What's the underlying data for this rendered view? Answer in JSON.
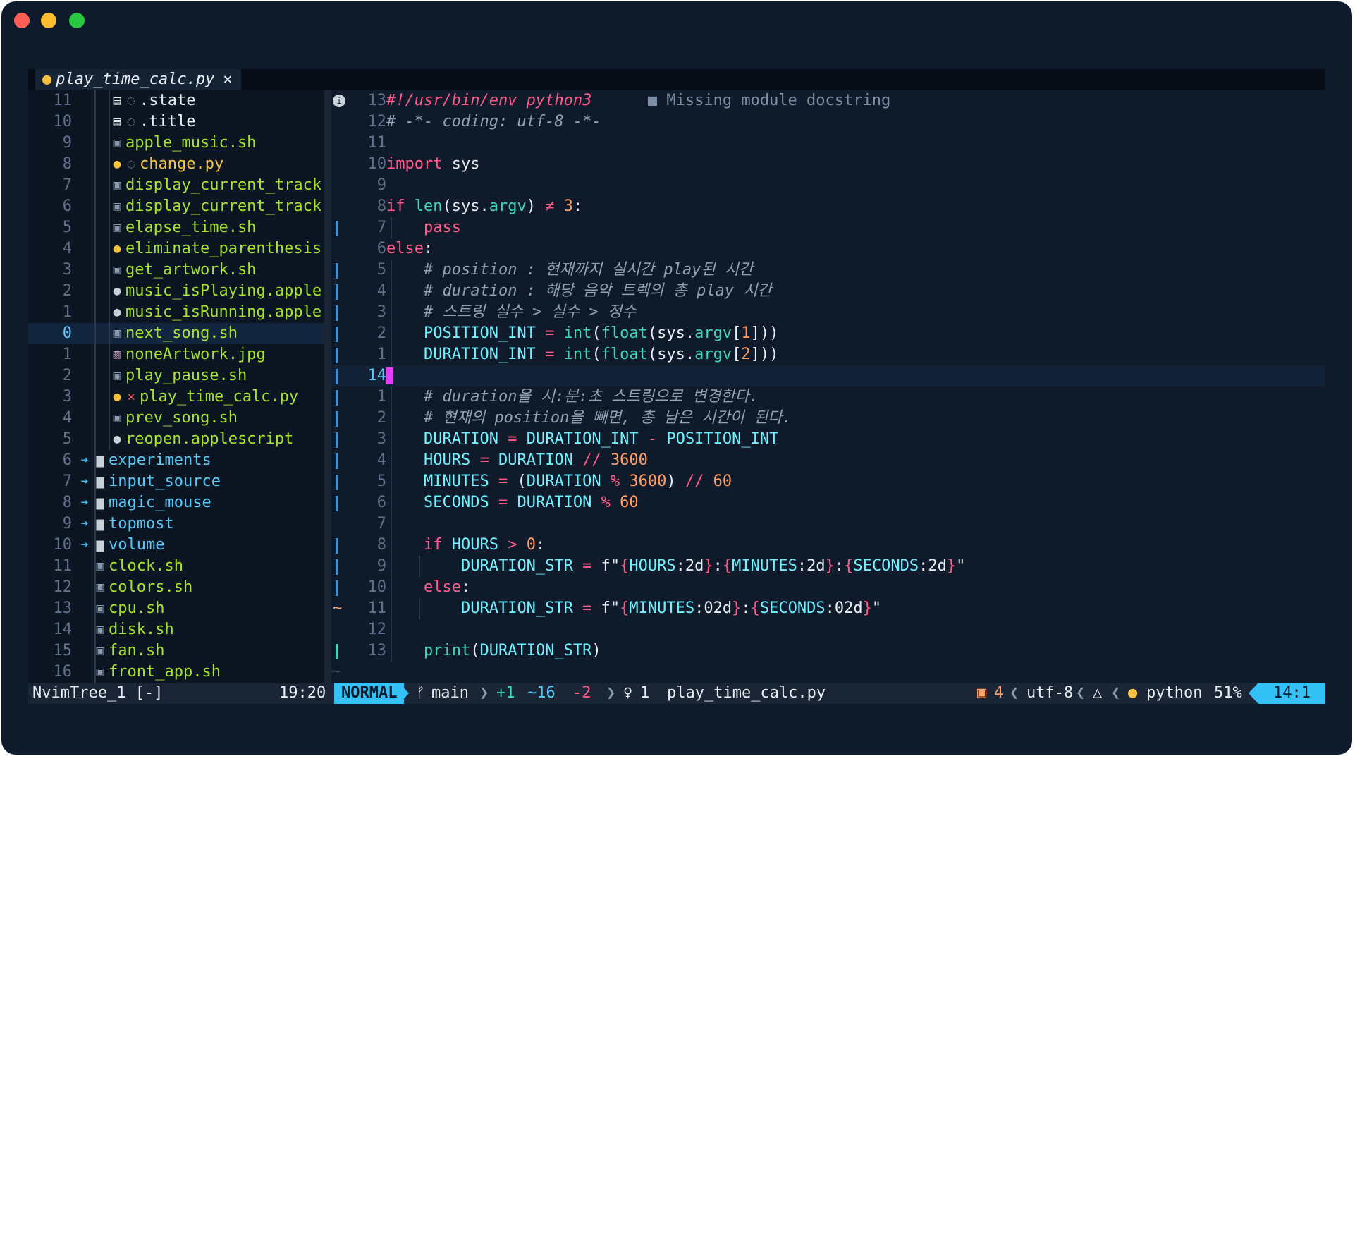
{
  "tab": {
    "icon": "python-icon",
    "filename": "play_time_calc.py",
    "close": "✕"
  },
  "tree": {
    "rows": [
      {
        "ln": "11",
        "depth": 2,
        "icon": "file-icon",
        "mark": "◌",
        "name": ".state",
        "kind": "plain"
      },
      {
        "ln": "10",
        "depth": 2,
        "icon": "file-icon",
        "mark": "◌",
        "name": ".title",
        "kind": "plain"
      },
      {
        "ln": "9",
        "depth": 2,
        "icon": "terminal-icon",
        "name": "apple_music.sh",
        "kind": "sh"
      },
      {
        "ln": "8",
        "depth": 2,
        "icon": "python-icon",
        "mark": "◌",
        "name": "change.py",
        "kind": "py"
      },
      {
        "ln": "7",
        "depth": 2,
        "icon": "terminal-icon",
        "name": "display_current_track",
        "kind": "sh"
      },
      {
        "ln": "6",
        "depth": 2,
        "icon": "terminal-icon",
        "name": "display_current_track",
        "kind": "sh"
      },
      {
        "ln": "5",
        "depth": 2,
        "icon": "terminal-icon",
        "name": "elapse_time.sh",
        "kind": "sh"
      },
      {
        "ln": "4",
        "depth": 2,
        "icon": "python-icon",
        "name": "eliminate_parenthesis",
        "kind": "sh"
      },
      {
        "ln": "3",
        "depth": 2,
        "icon": "terminal-icon",
        "name": "get_artwork.sh",
        "kind": "sh"
      },
      {
        "ln": "2",
        "depth": 2,
        "icon": "apple-icon",
        "name": "music_isPlaying.apple",
        "kind": "sh"
      },
      {
        "ln": "1",
        "depth": 2,
        "icon": "apple-icon",
        "name": "music_isRunning.apple",
        "kind": "sh"
      },
      {
        "ln": "0",
        "depth": 2,
        "icon": "terminal-icon",
        "name": "next_song.sh",
        "kind": "sh",
        "current": true
      },
      {
        "ln": "1",
        "depth": 2,
        "icon": "image-icon",
        "name": "noneArtwork.jpg",
        "kind": "sh"
      },
      {
        "ln": "2",
        "depth": 2,
        "icon": "terminal-icon",
        "name": "play_pause.sh",
        "kind": "sh"
      },
      {
        "ln": "3",
        "depth": 2,
        "icon": "python-icon",
        "mark": "✕",
        "name": "play_time_calc.py",
        "kind": "sh"
      },
      {
        "ln": "4",
        "depth": 2,
        "icon": "terminal-icon",
        "name": "prev_song.sh",
        "kind": "sh"
      },
      {
        "ln": "5",
        "depth": 2,
        "icon": "apple-icon",
        "name": "reopen.applescript",
        "kind": "sh"
      },
      {
        "ln": "6",
        "depth": 1,
        "icon": "folder-icon",
        "arrow": true,
        "name": "experiments",
        "kind": "dir"
      },
      {
        "ln": "7",
        "depth": 1,
        "icon": "folder-icon",
        "arrow": true,
        "name": "input_source",
        "kind": "dir"
      },
      {
        "ln": "8",
        "depth": 1,
        "icon": "folder-icon",
        "arrow": true,
        "name": "magic_mouse",
        "kind": "dir"
      },
      {
        "ln": "9",
        "depth": 1,
        "icon": "folder-icon",
        "arrow": true,
        "name": "topmost",
        "kind": "dir"
      },
      {
        "ln": "10",
        "depth": 1,
        "icon": "folder-icon",
        "arrow": true,
        "name": "volume",
        "kind": "dir"
      },
      {
        "ln": "11",
        "depth": 1,
        "icon": "terminal-icon",
        "name": "clock.sh",
        "kind": "sh"
      },
      {
        "ln": "12",
        "depth": 1,
        "icon": "terminal-icon",
        "name": "colors.sh",
        "kind": "sh"
      },
      {
        "ln": "13",
        "depth": 1,
        "icon": "terminal-icon",
        "name": "cpu.sh",
        "kind": "sh"
      },
      {
        "ln": "14",
        "depth": 1,
        "icon": "terminal-icon",
        "name": "disk.sh",
        "kind": "sh"
      },
      {
        "ln": "15",
        "depth": 1,
        "icon": "terminal-icon",
        "name": "fan.sh",
        "kind": "sh"
      },
      {
        "ln": "16",
        "depth": 1,
        "icon": "terminal-icon",
        "name": "front_app.sh",
        "kind": "sh"
      }
    ]
  },
  "editor": {
    "lines": [
      {
        "ln": "13",
        "sign": "info-icon",
        "html": "<span class=\"sb\">#!/usr/bin/env python3</span><span class=\"diag\">      ■ Missing module docstring</span>"
      },
      {
        "ln": "12",
        "html": "<span class=\"cm\"># -*- coding: utf-8 -*-</span>"
      },
      {
        "ln": "11",
        "html": ""
      },
      {
        "ln": "10",
        "html": "<span class=\"kw\">import</span> sys"
      },
      {
        "ln": "9",
        "html": ""
      },
      {
        "ln": "8",
        "html": "<span class=\"kw\">if</span> <span class=\"fn\">len</span>(sys.<span class=\"fn\">argv</span>) <span class=\"op\">≠</span> <span class=\"num\">3</span>:"
      },
      {
        "ln": "7",
        "git": "mod",
        "guide": 1,
        "html": "    <span class=\"kw\">pass</span>"
      },
      {
        "ln": "6",
        "html": "<span class=\"kw\">else</span>:"
      },
      {
        "ln": "5",
        "git": "mod",
        "guide": 1,
        "html": "    <span class=\"cm\"># position : 현재까지 실시간 play된 시간</span>"
      },
      {
        "ln": "4",
        "git": "mod",
        "guide": 1,
        "html": "    <span class=\"cm\"># duration : 해당 음악 트렉의 총 play 시간</span>"
      },
      {
        "ln": "3",
        "git": "mod",
        "guide": 1,
        "html": "    <span class=\"cm\"># 스트링 실수 > 실수 > 정수</span>"
      },
      {
        "ln": "2",
        "git": "mod",
        "guide": 1,
        "html": "    <span class=\"cst\">POSITION_INT</span> <span class=\"op\">=</span> <span class=\"fn\">int</span>(<span class=\"fn\">float</span>(sys.<span class=\"fn\">argv</span>[<span class=\"num\">1</span>]))"
      },
      {
        "ln": "1",
        "git": "mod",
        "guide": 1,
        "html": "    <span class=\"cst\">DURATION_INT</span> <span class=\"op\">=</span> <span class=\"fn\">int</span>(<span class=\"fn\">float</span>(sys.<span class=\"fn\">argv</span>[<span class=\"num\">2</span>]))"
      },
      {
        "ln": "14",
        "current": true,
        "git": "mod",
        "cursor": true,
        "html": ""
      },
      {
        "ln": "1",
        "git": "mod",
        "guide": 1,
        "html": "    <span class=\"cm\"># duration을 시:분:초 스트링으로 변경한다.</span>"
      },
      {
        "ln": "2",
        "git": "mod",
        "guide": 1,
        "html": "    <span class=\"cm\"># 현재의 position을 빼면, 총 남은 시간이 된다.</span>"
      },
      {
        "ln": "3",
        "git": "mod",
        "guide": 1,
        "html": "    <span class=\"cst\">DURATION</span> <span class=\"op\">=</span> <span class=\"cst\">DURATION_INT</span> <span class=\"op\">-</span> <span class=\"cst\">POSITION_INT</span>"
      },
      {
        "ln": "4",
        "git": "mod",
        "guide": 1,
        "html": "    <span class=\"cst\">HOURS</span> <span class=\"op\">=</span> <span class=\"cst\">DURATION</span> <span class=\"op\">//</span> <span class=\"num\">3600</span>"
      },
      {
        "ln": "5",
        "git": "mod",
        "guide": 1,
        "html": "    <span class=\"cst\">MINUTES</span> <span class=\"op\">=</span> (<span class=\"cst\">DURATION</span> <span class=\"op\">%</span> <span class=\"num\">3600</span>) <span class=\"op\">//</span> <span class=\"num\">60</span>"
      },
      {
        "ln": "6",
        "git": "mod",
        "guide": 1,
        "html": "    <span class=\"cst\">SECONDS</span> <span class=\"op\">=</span> <span class=\"cst\">DURATION</span> <span class=\"op\">%</span> <span class=\"num\">60</span>"
      },
      {
        "ln": "7",
        "guide": 1,
        "html": ""
      },
      {
        "ln": "8",
        "git": "mod",
        "guide": 1,
        "html": "    <span class=\"kw\">if</span> <span class=\"cst\">HOURS</span> <span class=\"op\">></span> <span class=\"num\">0</span>:"
      },
      {
        "ln": "9",
        "git": "mod",
        "guide": 2,
        "html": "        <span class=\"cst\">DURATION_STR</span> <span class=\"op\">=</span> f\"<span class=\"brace\">{</span><span class=\"intp\">HOURS</span>:2d<span class=\"brace\">}</span>:<span class=\"brace\">{</span><span class=\"intp\">MINUTES</span>:2d<span class=\"brace\">}</span>:<span class=\"brace\">{</span><span class=\"intp\">SECONDS</span>:2d<span class=\"brace\">}</span>\""
      },
      {
        "ln": "10",
        "git": "mod",
        "guide": 1,
        "html": "    <span class=\"kw\">else</span>:"
      },
      {
        "ln": "11",
        "git": "chg",
        "guide": 2,
        "html": "        <span class=\"cst\">DURATION_STR</span> <span class=\"op\">=</span> f\"<span class=\"brace\">{</span><span class=\"intp\">MINUTES</span>:02d<span class=\"brace\">}</span>:<span class=\"brace\">{</span><span class=\"intp\">SECONDS</span>:02d<span class=\"brace\">}</span>\""
      },
      {
        "ln": "12",
        "guide": 1,
        "html": ""
      },
      {
        "ln": "13",
        "git": "add",
        "guide": 1,
        "html": "    <span class=\"fn\">print</span>(<span class=\"cst\">DURATION_STR</span>)"
      }
    ],
    "tilde": "~"
  },
  "status": {
    "tree_name": "NvimTree_1 [-]",
    "tree_pos": "19:20",
    "mode": "NORMAL",
    "branch_icon": "git-branch-icon",
    "branch": "main",
    "diff_add": "+1",
    "diff_mod": "~16",
    "diff_del": "-2",
    "lsp_icon": "lightbulb-icon",
    "lsp_count": "1",
    "filename": "play_time_calc.py",
    "pkg_icon": "package-icon",
    "pkg_count": "4",
    "encoding": "utf-8",
    "os_icon": "linux-icon",
    "filetype_icon": "python-icon",
    "filetype": "python",
    "percent": "51%",
    "position": "14:1"
  },
  "colors": {
    "mode_bg": "#34c1f5",
    "window_bg": "#0f1a2b",
    "sh": "#a7e22e",
    "py": "#f7c340",
    "dir": "#56c8f5"
  }
}
